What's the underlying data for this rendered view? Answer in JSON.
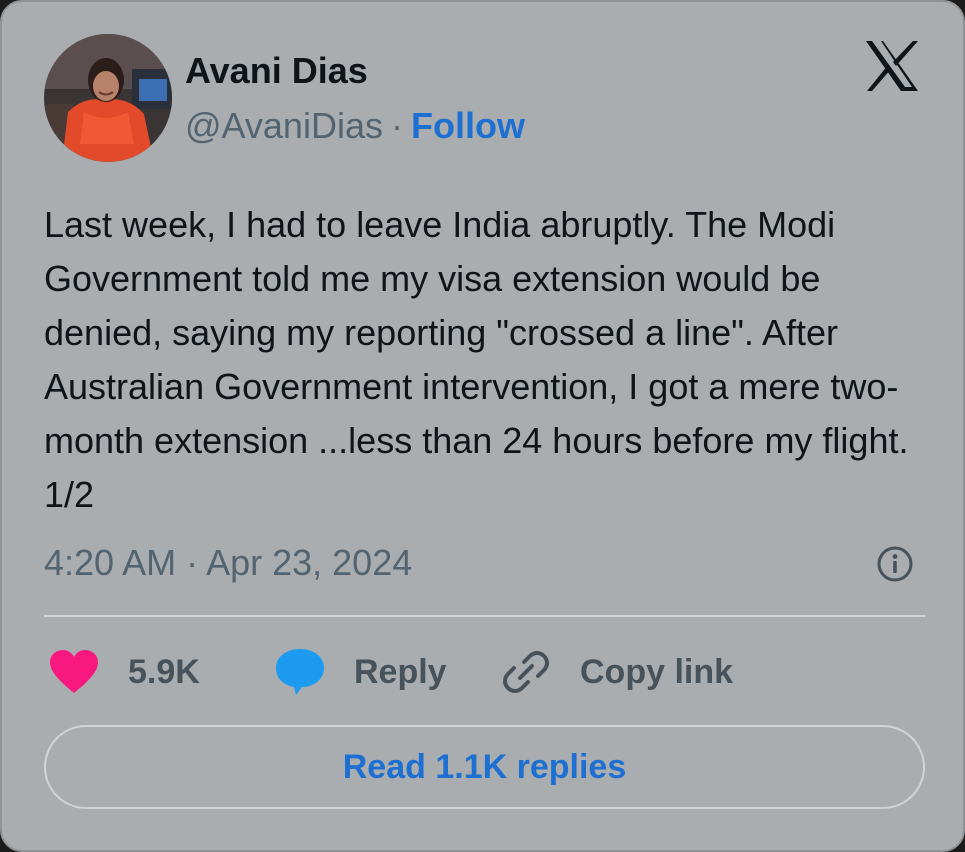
{
  "author": {
    "name": "Avani Dias",
    "handle": "@AvaniDias",
    "separator": "·",
    "follow_label": "Follow",
    "avatar_icon": "profile-photo"
  },
  "brand": {
    "logo_icon": "x-logo-icon"
  },
  "tweet": {
    "text": "Last week, I had to leave India abruptly. The Modi Government told me my visa extension would be denied, saying my reporting \"crossed a line\". After Australian Government intervention, I got a mere two-month extension ...less than 24 hours before my flight. 1/2",
    "timestamp": "4:20 AM · Apr 23, 2024"
  },
  "actions": {
    "like_count": "5.9K",
    "reply_label": "Reply",
    "copy_link_label": "Copy link",
    "read_replies_label": "Read 1.1K replies"
  },
  "colors": {
    "card_background": "#a9adb0",
    "accent": "#1d6fd1",
    "like": "#f91880",
    "reply": "#1d9bf0",
    "secondary_text": "#536470"
  }
}
